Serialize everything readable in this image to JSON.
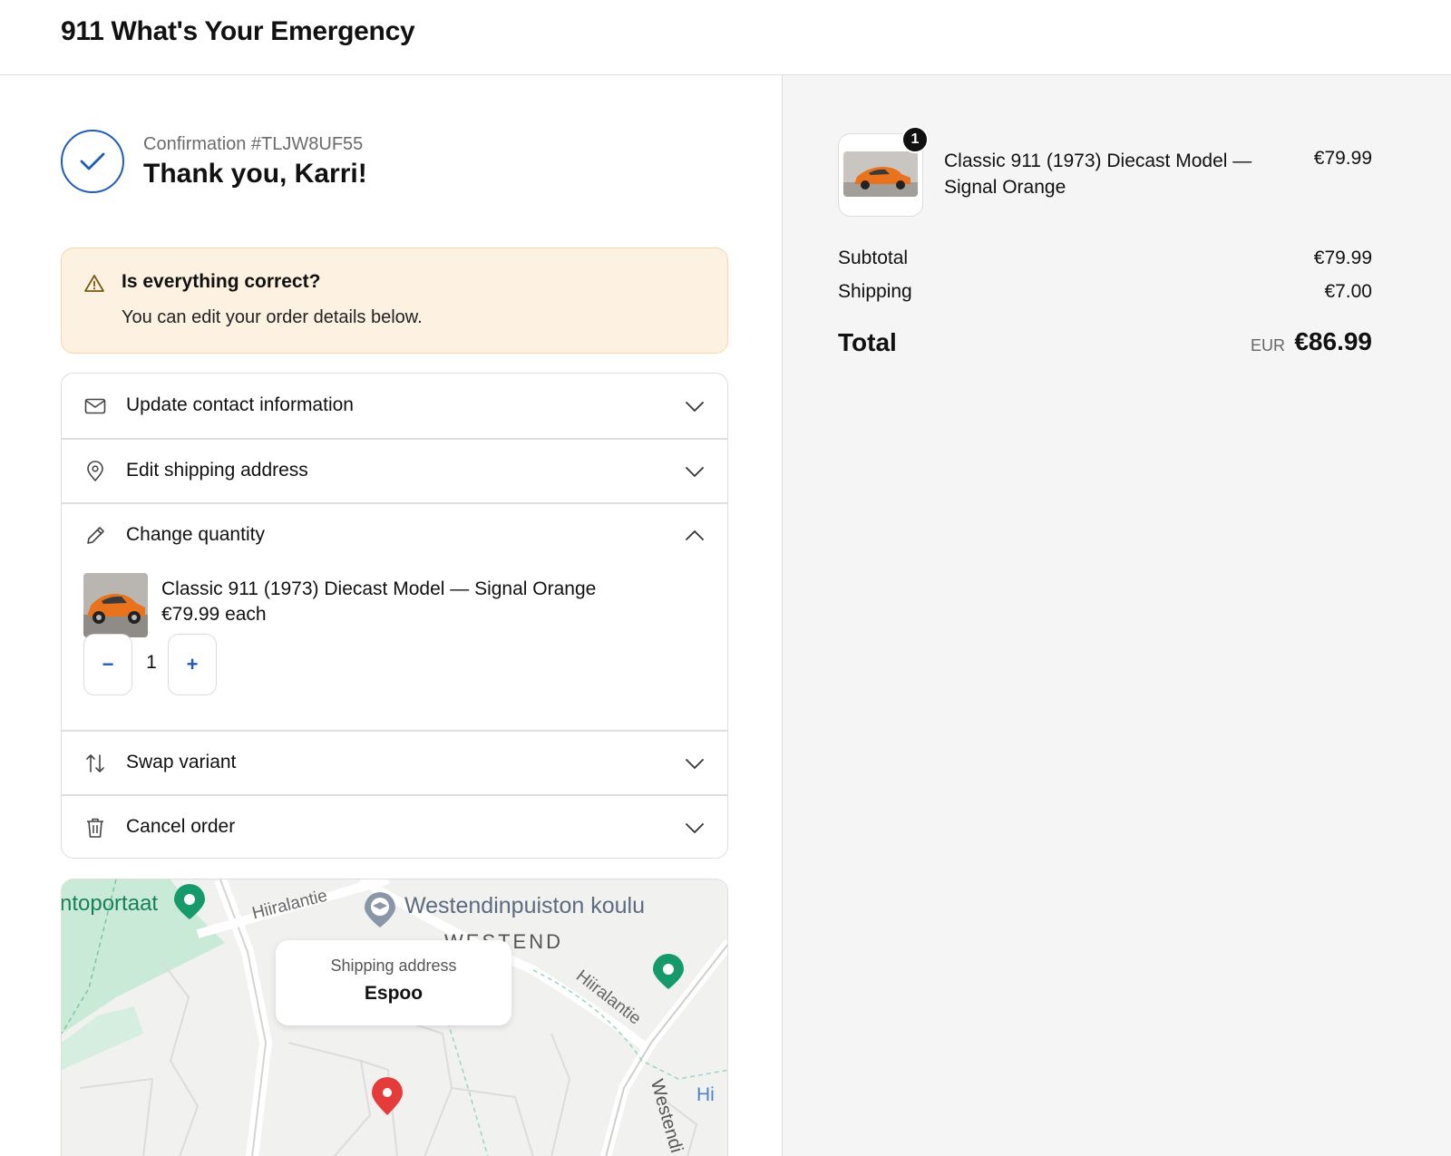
{
  "header": {
    "shop_name": "911 What's Your Emergency"
  },
  "confirmation": {
    "number_text": "Confirmation #TLJW8UF55",
    "thank_you": "Thank you, Karri!"
  },
  "notice": {
    "title": "Is everything correct?",
    "text": "You can edit your order details below.",
    "icon": "warning-triangle-icon"
  },
  "accordion": {
    "items": [
      {
        "label": "Update contact information",
        "icon": "mail-icon",
        "expanded": false
      },
      {
        "label": "Edit shipping address",
        "icon": "location-pin-icon",
        "expanded": false
      },
      {
        "label": "Change quantity",
        "icon": "pencil-icon",
        "expanded": true
      },
      {
        "label": "Swap variant",
        "icon": "swap-arrows-icon",
        "expanded": false
      },
      {
        "label": "Cancel order",
        "icon": "trash-icon",
        "expanded": false
      }
    ],
    "quantity_panel": {
      "product_name": "Classic 911 (1973) Diecast Model — Signal Orange",
      "unit_price": "€79.99 each",
      "quantity": "1",
      "minus_label": "−",
      "plus_label": "+"
    }
  },
  "map": {
    "popup_caption": "Shipping address",
    "popup_city": "Espoo",
    "labels": {
      "place_left": "ntoportaat",
      "street_top": "Hiiralantie",
      "school": "Westendinpuiston koulu",
      "district": "WESTEND",
      "street_right": "Hiiralantie",
      "street_vertical": "Westendi",
      "edge_label": "Hi"
    }
  },
  "summary": {
    "item": {
      "quantity_badge": "1",
      "name": "Classic 911 (1973) Diecast Model — Signal Orange",
      "price": "€79.99"
    },
    "subtotal_label": "Subtotal",
    "subtotal_value": "€79.99",
    "shipping_label": "Shipping",
    "shipping_value": "€7.00",
    "total_label": "Total",
    "total_currency": "EUR",
    "total_value": "€86.99"
  },
  "colors": {
    "accent": "#1f5bb8",
    "notice_bg": "#fdf1e2",
    "notice_border": "#f6d6a8",
    "summary_bg": "#f5f5f5",
    "product_orange": "#e8731c"
  }
}
